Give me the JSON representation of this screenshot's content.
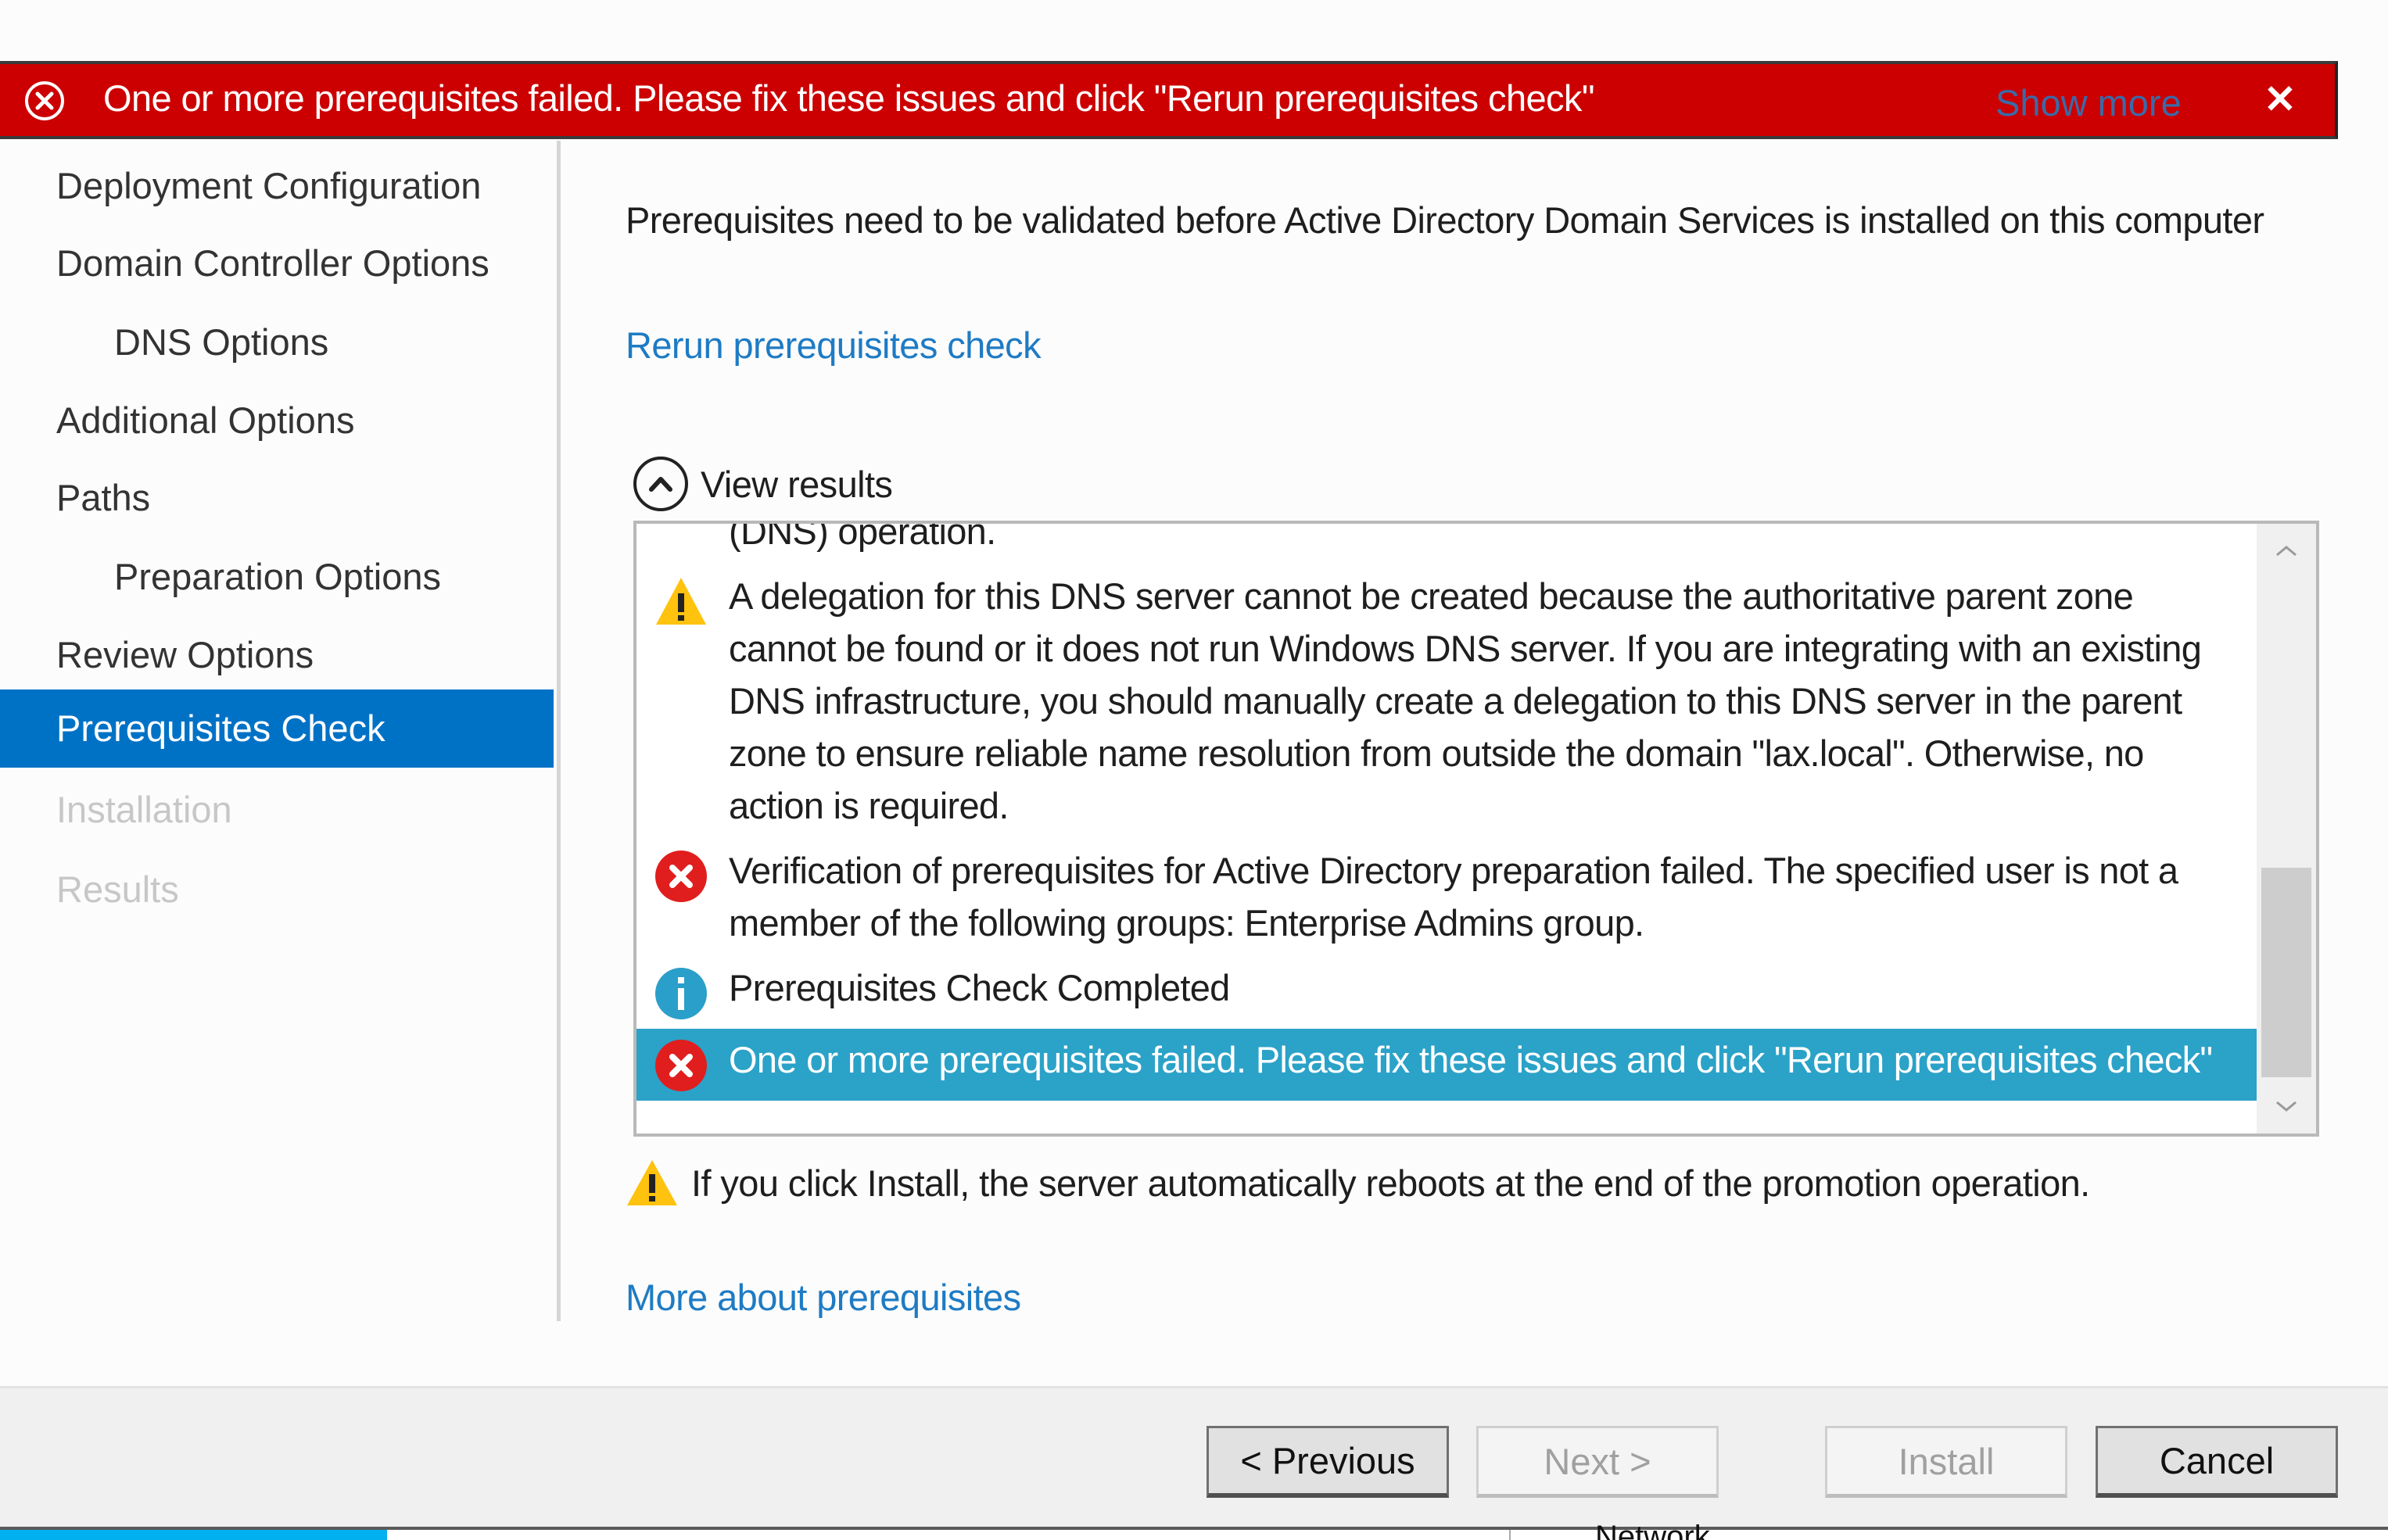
{
  "banner": {
    "icon": "error-circle-icon",
    "message": "One or more prerequisites failed.  Please fix these issues and click \"Rerun prerequisites check\"",
    "show_more": "Show more",
    "close": "✕",
    "color": "#cc0000"
  },
  "sidebar": {
    "items": [
      {
        "label": "Deployment Configuration",
        "state": "normal",
        "indent": false
      },
      {
        "label": "Domain Controller Options",
        "state": "normal",
        "indent": false
      },
      {
        "label": "DNS Options",
        "state": "normal",
        "indent": true
      },
      {
        "label": "Additional Options",
        "state": "normal",
        "indent": false
      },
      {
        "label": "Paths",
        "state": "normal",
        "indent": false
      },
      {
        "label": "Preparation Options",
        "state": "normal",
        "indent": true
      },
      {
        "label": "Review Options",
        "state": "normal",
        "indent": false
      },
      {
        "label": "Prerequisites Check",
        "state": "selected",
        "indent": false
      },
      {
        "label": "Installation",
        "state": "disabled",
        "indent": false
      },
      {
        "label": "Results",
        "state": "disabled",
        "indent": false
      }
    ],
    "selected_color": "#0072c6"
  },
  "main": {
    "description": "Prerequisites need to be validated before Active Directory Domain Services is installed on this computer",
    "rerun_link": "Rerun prerequisites check",
    "view_results": "View results",
    "results": [
      {
        "type": "clipped",
        "icon": "",
        "text": "(DNS) operation."
      },
      {
        "type": "warning",
        "icon": "warning-icon",
        "text": "A delegation for this DNS server cannot be created because the authoritative parent zone cannot be found or it does not run Windows DNS server. If you are integrating with an existing DNS infrastructure, you should manually create a delegation to this DNS server in the parent zone to ensure reliable name resolution from outside the domain \"lax.local\". Otherwise, no action is required."
      },
      {
        "type": "error",
        "icon": "error-icon",
        "text": "Verification of prerequisites for Active Directory preparation failed. The specified user is not a member of the following groups: Enterprise Admins group."
      },
      {
        "type": "info",
        "icon": "info-icon",
        "text": "Prerequisites Check Completed"
      },
      {
        "type": "error",
        "icon": "error-icon",
        "text": "One or more prerequisites failed.  Please fix these issues and click \"Rerun prerequisites check\"",
        "selected": true
      }
    ],
    "reboot_warning": "If you click Install, the server automatically reboots at the end of the promotion operation.",
    "more_link": "More about prerequisites",
    "selected_row_color": "#2ba2c8"
  },
  "footer": {
    "buttons": [
      {
        "label": "< Previous",
        "enabled": true
      },
      {
        "label": "Next >",
        "enabled": false
      },
      {
        "label": "Install",
        "enabled": false
      },
      {
        "label": "Cancel",
        "enabled": true
      }
    ]
  },
  "background_window": {
    "label": "Network"
  }
}
